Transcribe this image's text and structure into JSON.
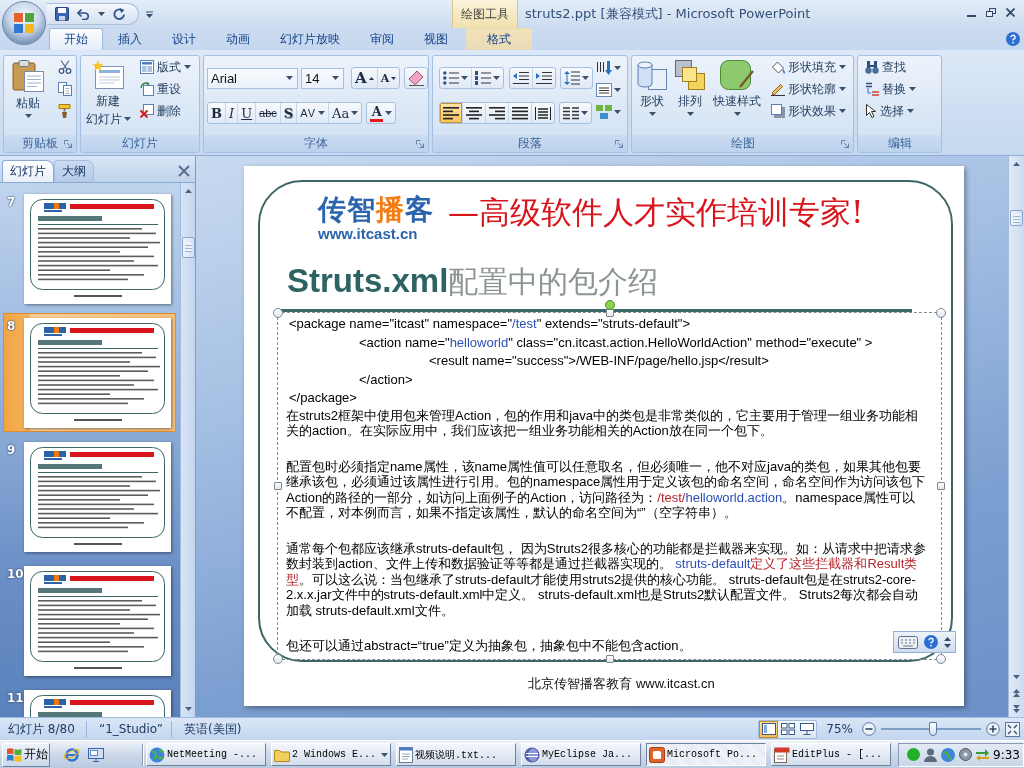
{
  "title_bar": {
    "contextual_group": "绘图工具",
    "title": "struts2.ppt [兼容模式] - Microsoft PowerPoint"
  },
  "ribbon_tabs": [
    {
      "label": "开始",
      "selected": true,
      "kind": "main"
    },
    {
      "label": "插入",
      "selected": false,
      "kind": "main"
    },
    {
      "label": "设计",
      "selected": false,
      "kind": "main"
    },
    {
      "label": "动画",
      "selected": false,
      "kind": "main"
    },
    {
      "label": "幻灯片放映",
      "selected": false,
      "kind": "main"
    },
    {
      "label": "审阅",
      "selected": false,
      "kind": "main"
    },
    {
      "label": "视图",
      "selected": false,
      "kind": "main"
    },
    {
      "label": "格式",
      "selected": false,
      "kind": "contextual"
    }
  ],
  "ribbon": {
    "clipboard": {
      "caption": "剪贴板",
      "paste": "粘贴"
    },
    "slides": {
      "caption": "幻灯片",
      "new_slide": [
        "新建",
        "幻灯片"
      ],
      "commands": [
        {
          "label": "版式",
          "kind": "layout",
          "menu": true
        },
        {
          "label": "重设",
          "kind": "reset",
          "menu": false
        },
        {
          "label": "删除",
          "kind": "delete",
          "menu": false
        }
      ]
    },
    "font": {
      "caption": "字体",
      "font_name": "Arial",
      "font_size": "14",
      "grow": "A",
      "shrink": "A",
      "styles": [
        {
          "label": "B",
          "kind": "bold",
          "menu": false
        },
        {
          "label": "I",
          "kind": "italic",
          "menu": false
        },
        {
          "label": "U",
          "kind": "underline",
          "menu": false
        },
        {
          "label": "abc",
          "kind": "strike",
          "menu": false
        },
        {
          "label": "S",
          "kind": "shadow",
          "menu": false
        },
        {
          "label": "AV",
          "kind": "spacing",
          "menu": true
        },
        {
          "label": "Aa",
          "kind": "case",
          "menu": true
        },
        {
          "label": "A",
          "kind": "color",
          "menu": true
        }
      ]
    },
    "paragraph": {
      "caption": "段落",
      "alignments": [
        {
          "kind": "left",
          "selected": true
        },
        {
          "kind": "center",
          "selected": false
        },
        {
          "kind": "right",
          "selected": false
        },
        {
          "kind": "justify",
          "selected": false
        },
        {
          "kind": "distributed",
          "selected": false
        }
      ]
    },
    "drawing": {
      "caption": "绘图",
      "big_buttons": [
        {
          "label": "形状",
          "kind": "shapes"
        },
        {
          "label": "排列",
          "kind": "arrange"
        },
        {
          "label": "快速样式",
          "kind": "styles"
        }
      ],
      "commands": [
        {
          "label": "形状填充",
          "kind": "fill"
        },
        {
          "label": "形状轮廓",
          "kind": "outline"
        },
        {
          "label": "形状效果",
          "kind": "effects"
        }
      ]
    },
    "editing": {
      "caption": "编辑",
      "commands": [
        {
          "label": "查找",
          "kind": "find",
          "menu": false
        },
        {
          "label": "替换",
          "kind": "replace",
          "menu": true
        },
        {
          "label": "选择",
          "kind": "select",
          "menu": true
        }
      ]
    }
  },
  "slides_pane": {
    "tabs": [
      {
        "label": "幻灯片",
        "selected": true
      },
      {
        "label": "大纲",
        "selected": false
      }
    ],
    "thumbnails": [
      {
        "number": "7",
        "selected": false
      },
      {
        "number": "8",
        "selected": true
      },
      {
        "number": "9",
        "selected": false
      },
      {
        "number": "10",
        "selected": false
      },
      {
        "number": "11",
        "selected": false
      }
    ]
  },
  "slide": {
    "brand": [
      {
        "text": "传智",
        "kind": "primary"
      },
      {
        "text": "播",
        "kind": "accent"
      },
      {
        "text": "客",
        "kind": "primary"
      }
    ],
    "url": "www.itcast.cn",
    "slogan": "—高级软件人才实作培训专家!",
    "title": "**Struts.xml**配置中的包介绍",
    "code": [
      {
        "segments": [
          {
            "text": "<package name=\"itcast\" namespace=\"",
            "kind": "plain"
          },
          {
            "text": "/test",
            "kind": "value"
          },
          {
            "text": "\" extends=\"struts-default\">",
            "kind": "plain"
          }
        ],
        "children": [
          {
            "segments": [
              {
                "text": "<action name=\"",
                "kind": "plain"
              },
              {
                "text": "helloworld",
                "kind": "value"
              },
              {
                "text": "\" class=\"cn.itcast.action.HelloWorldAction\" method=\"execute\" >",
                "kind": "plain"
              }
            ],
            "children": [
              {
                "segments": [
                  {
                    "text": "<result name=\"success\">/WEB-INF/page/hello.jsp</result>",
                    "kind": "plain"
                  }
                ]
              }
            ]
          },
          {
            "segments": [
              {
                "text": "</action>",
                "kind": "plain"
              }
            ]
          }
        ]
      },
      {
        "segments": [
          {
            "text": "</package>",
            "kind": "plain"
          }
        ]
      }
    ],
    "paragraphs": [
      [
        {
          "text": "在struts2框架中使用包来管理Action，包的作用和java中的类包是非常类似的，它主要用于管理一组业务功能相关的action。在实际应用中，我们应该把一组业务功能相关的Action放在同一个包下。",
          "kind": "plain"
        }
      ],
      [
        {
          "text": "配置包时必须指定name属性，该name属性值可以任意取名，但必须唯一，他不对应java的类包，如果其他包要继承该包，必须通过该属性进行引用。包的namespace属性用于定义该包的命名空间，命名空间作为访问该包下Action的路径的一部分，如访问上面例子的Action，访问路径为：",
          "kind": "plain"
        },
        {
          "text": "/test/",
          "kind": "accent"
        },
        {
          "text": "helloworld.action",
          "kind": "value"
        },
        {
          "text": "。namespace属性可以不配置，对本例而言，如果不指定该属性，默认的命名空间为“”（空字符串）。",
          "kind": "plain"
        }
      ],
      [
        {
          "text": "通常每个包都应该继承struts-default包， 因为Struts2很多核心的功能都是拦截器来实现。如：从请求中把请求参数封装到action、文件上传和数据验证等等都是通过拦截器实现的。 ",
          "kind": "plain"
        },
        {
          "text": "struts-default",
          "kind": "value"
        },
        {
          "text": "定义了这些拦截器和Result类型",
          "kind": "accent"
        },
        {
          "text": "。可以这么说：当包继承了struts-default才能使用struts2提供的核心功能。 struts-default包是在struts2-core-2.x.x.jar文件中的struts-default.xml中定义。 struts-default.xml也是Struts2默认配置文件。 Struts2每次都会自动加载 struts-default.xml文件。",
          "kind": "plain"
        }
      ],
      [
        {
          "text": "包还可以通过abstract=“true”定义为抽象包，抽象包中不能包含action。",
          "kind": "plain"
        }
      ]
    ],
    "footer": "北京传智播客教育 www.itcast.cn"
  },
  "status_bar": {
    "slide_counter": "幻灯片 8/80",
    "theme": "“1_Studio”",
    "language": "英语(美国)",
    "views": [
      {
        "kind": "normal",
        "selected": true
      },
      {
        "kind": "sorter",
        "selected": false
      },
      {
        "kind": "show",
        "selected": false
      }
    ],
    "zoom": "75%",
    "zoom_slider": {
      "level": 0.52
    }
  },
  "taskbar": {
    "start": "开始",
    "tasks": [
      {
        "label": "NetMeeting -...",
        "kind": "globe",
        "selected": false,
        "grouped": false
      },
      {
        "label": "2 Windows E...",
        "kind": "folder",
        "selected": false,
        "grouped": true
      },
      {
        "label": "视频说明.txt...",
        "kind": "text",
        "selected": false,
        "grouped": false
      },
      {
        "label": "MyEclipse Ja...",
        "kind": "sphere",
        "selected": false,
        "grouped": false
      },
      {
        "label": "Microsoft Po...",
        "kind": "slides",
        "selected": true,
        "grouped": false
      },
      {
        "label": "EditPlus - [...",
        "kind": "editor",
        "selected": false,
        "grouped": false
      }
    ],
    "clock": "9:33"
  }
}
